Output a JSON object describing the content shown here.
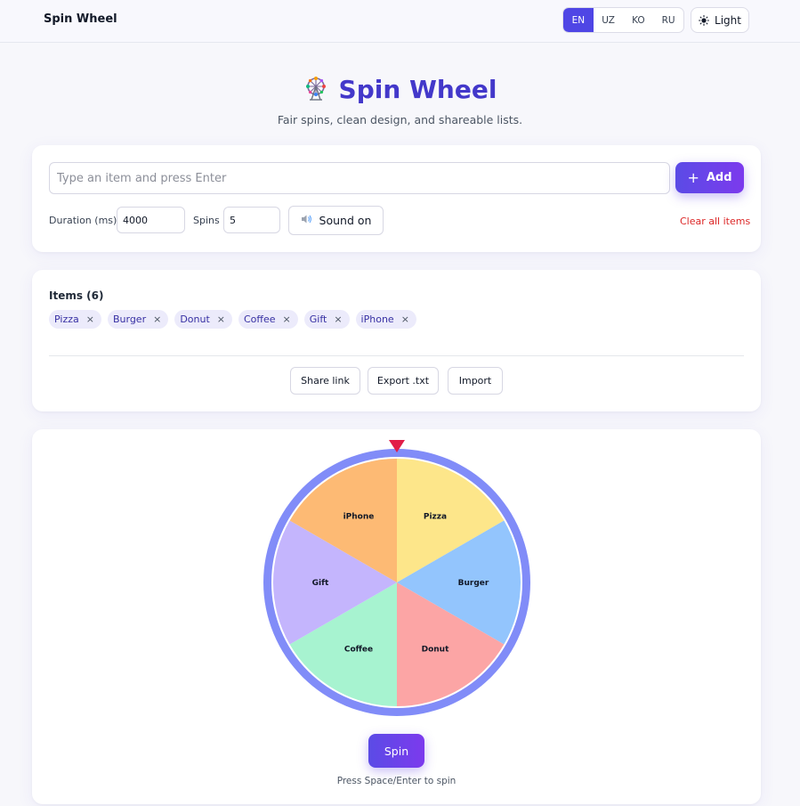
{
  "app": {
    "brand": "Spin Wheel",
    "theme_label": "Light",
    "theme_icon": "sun-icon"
  },
  "languages": [
    {
      "code": "EN",
      "active": true
    },
    {
      "code": "UZ",
      "active": false
    },
    {
      "code": "KO",
      "active": false
    },
    {
      "code": "RU",
      "active": false
    }
  ],
  "hero": {
    "icon": "ferris-wheel-icon",
    "title": "Spin Wheel",
    "subtitle": "Fair spins, clean design, and shareable lists."
  },
  "controls": {
    "input_placeholder": "Type an item and press Enter",
    "add_label": "Add",
    "duration_label": "Duration (ms)",
    "duration_value": "4000",
    "spins_label": "Spins",
    "spins_value": "5",
    "sound_label": "Sound on",
    "clear_label": "Clear all items"
  },
  "items_panel": {
    "heading": "Items (6)",
    "items": [
      "Pizza",
      "Burger",
      "Donut",
      "Coffee",
      "Gift",
      "iPhone"
    ],
    "remove_glyph": "×",
    "share_label": "Share link",
    "export_label": "Export .txt",
    "import_label": "Import"
  },
  "wheel": {
    "segments": [
      {
        "label": "Pizza",
        "color": "#fde68a"
      },
      {
        "label": "Burger",
        "color": "#93c5fd"
      },
      {
        "label": "Donut",
        "color": "#fca5a5"
      },
      {
        "label": "Coffee",
        "color": "#a7f3d0"
      },
      {
        "label": "Gift",
        "color": "#c4b5fd"
      },
      {
        "label": "iPhone",
        "color": "#fdba74"
      }
    ],
    "rim_color": "#818cf8",
    "pointer_color": "#e11d48",
    "spin_label": "Spin",
    "hint": "Press Space/Enter to spin"
  }
}
